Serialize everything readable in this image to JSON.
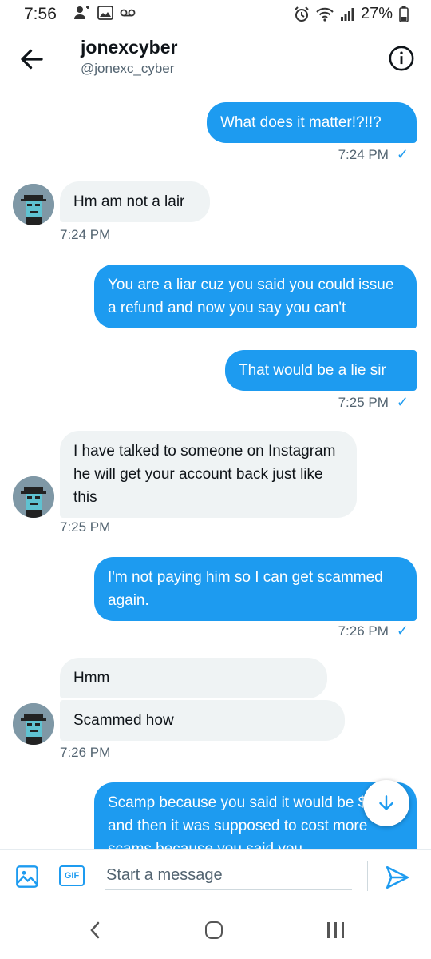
{
  "status_bar": {
    "time": "7:56",
    "battery": "27%"
  },
  "header": {
    "name": "jonexcyber",
    "handle": "@jonexc_cyber"
  },
  "colors": {
    "accent": "#1d9bf0",
    "incoming_bubble": "#eff3f4",
    "muted_text": "#536471"
  },
  "messages": [
    {
      "direction": "out",
      "text": "What does it matter!?!!?"
    },
    {
      "direction": "out",
      "timestamp": "7:24 PM",
      "read": true
    },
    {
      "direction": "in",
      "text": "Hm am not a lair"
    },
    {
      "direction": "in",
      "timestamp": "7:24 PM"
    },
    {
      "direction": "out",
      "text": "You are a liar cuz you said you could issue a refund and now you say you can't"
    },
    {
      "direction": "out",
      "text": "That would be a lie sir"
    },
    {
      "direction": "out",
      "timestamp": "7:25 PM",
      "read": true
    },
    {
      "direction": "in",
      "text": "I have talked to someone on Instagram he will get your account back just like this"
    },
    {
      "direction": "in",
      "timestamp": "7:25 PM"
    },
    {
      "direction": "out",
      "text": "I'm not paying him so I can get scammed again."
    },
    {
      "direction": "out",
      "timestamp": "7:26 PM",
      "read": true
    },
    {
      "direction": "in",
      "text": "Hmm"
    },
    {
      "direction": "in",
      "text": "Scammed how"
    },
    {
      "direction": "in",
      "timestamp": "7:26 PM"
    },
    {
      "direction": "out",
      "text": "Scamp because you said it would be $60 and then it was supposed to cost more scams because you said you"
    }
  ],
  "composer": {
    "placeholder": "Start a message",
    "gif_label": "GIF"
  },
  "icons": {
    "back": "arrow-left-icon",
    "info": "info-icon",
    "image": "image-icon",
    "send": "send-icon",
    "scroll_down": "arrow-down-icon"
  }
}
